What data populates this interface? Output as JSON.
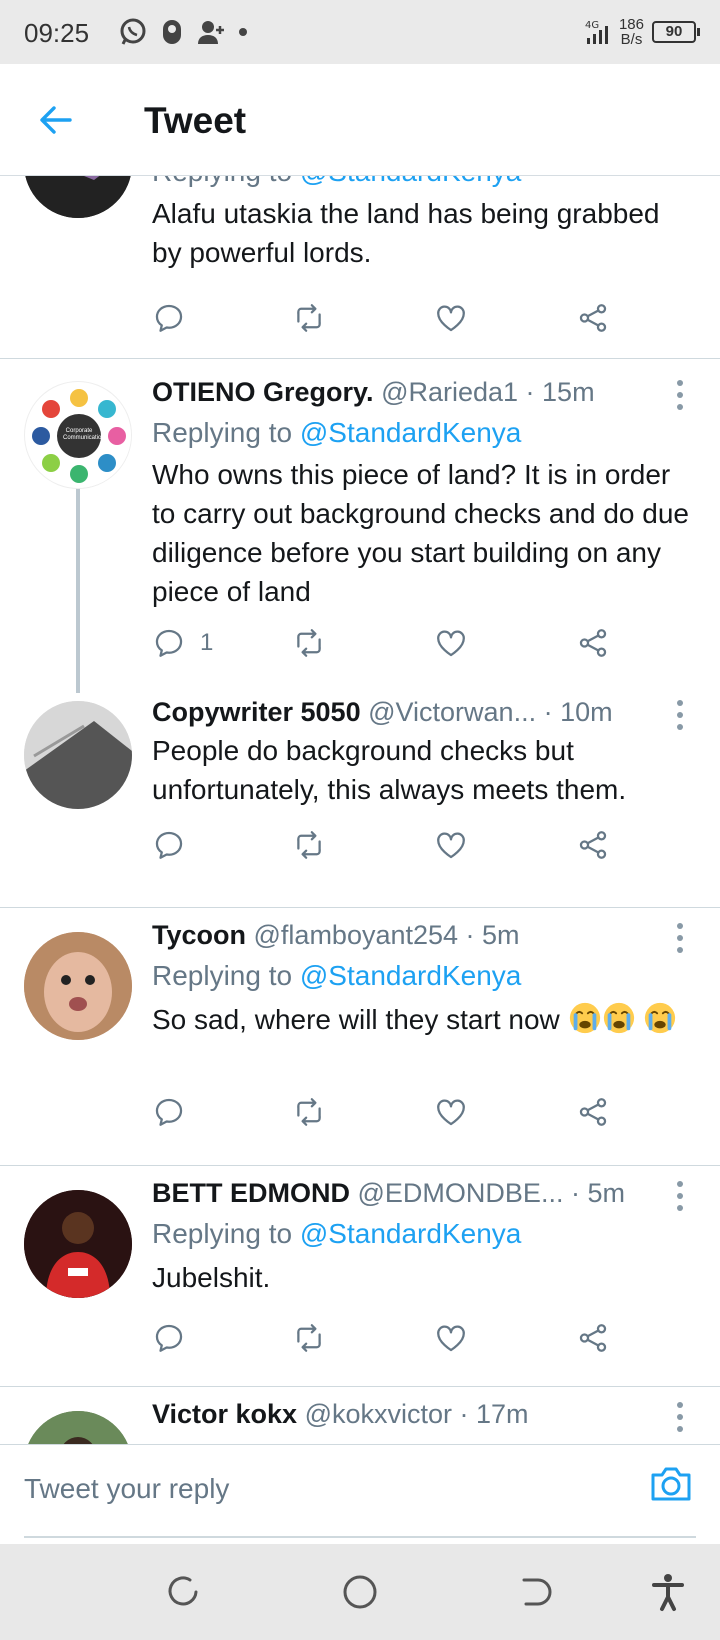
{
  "status_bar": {
    "time": "09:25",
    "network_type": "4G",
    "speed_value": "186",
    "speed_unit": "B/s",
    "battery": "90"
  },
  "header": {
    "title": "Tweet",
    "back_icon": "arrow-left-icon"
  },
  "colors": {
    "accent": "#1da1f2",
    "secondary_text": "#657786",
    "divider": "#cfd9de"
  },
  "tweets": [
    {
      "reply_prefix": "Replying to",
      "reply_handle": "@StandardKenya",
      "text": "Alafu utaskia the land has being grabbed by powerful lords."
    },
    {
      "name": "OTIENO Gregory.",
      "meta": "@Rarieda1 · 15m",
      "reply_prefix": "Replying to",
      "reply_handle": "@StandardKenya",
      "text": "Who owns this piece of land? It is in order to carry out background checks and do due diligence before you start building on any piece of land",
      "reply_count": "1",
      "avatar_text": "Corporate Communication"
    },
    {
      "name": "Copywriter 5050",
      "meta": "@Victorwan... · 10m",
      "text": "People do background checks but unfortunately, this always meets them."
    },
    {
      "name": "Tycoon",
      "meta": "@flamboyant254 · 5m",
      "reply_prefix": "Replying to",
      "reply_handle": "@StandardKenya",
      "text": "So sad, where will they start now"
    },
    {
      "name": "BETT EDMOND",
      "meta": "@EDMONDBE... · 5m",
      "reply_prefix": "Replying to",
      "reply_handle": "@StandardKenya",
      "text": "Jubelshit."
    },
    {
      "name": "Victor kokx",
      "meta": "@kokxvictor · 17m"
    }
  ],
  "reply_bar": {
    "placeholder": "Tweet your reply",
    "camera_icon": "camera-icon"
  },
  "nav_bar": {
    "icons": [
      "recents-icon",
      "home-circle-icon",
      "back-nav-icon",
      "accessibility-icon"
    ]
  }
}
